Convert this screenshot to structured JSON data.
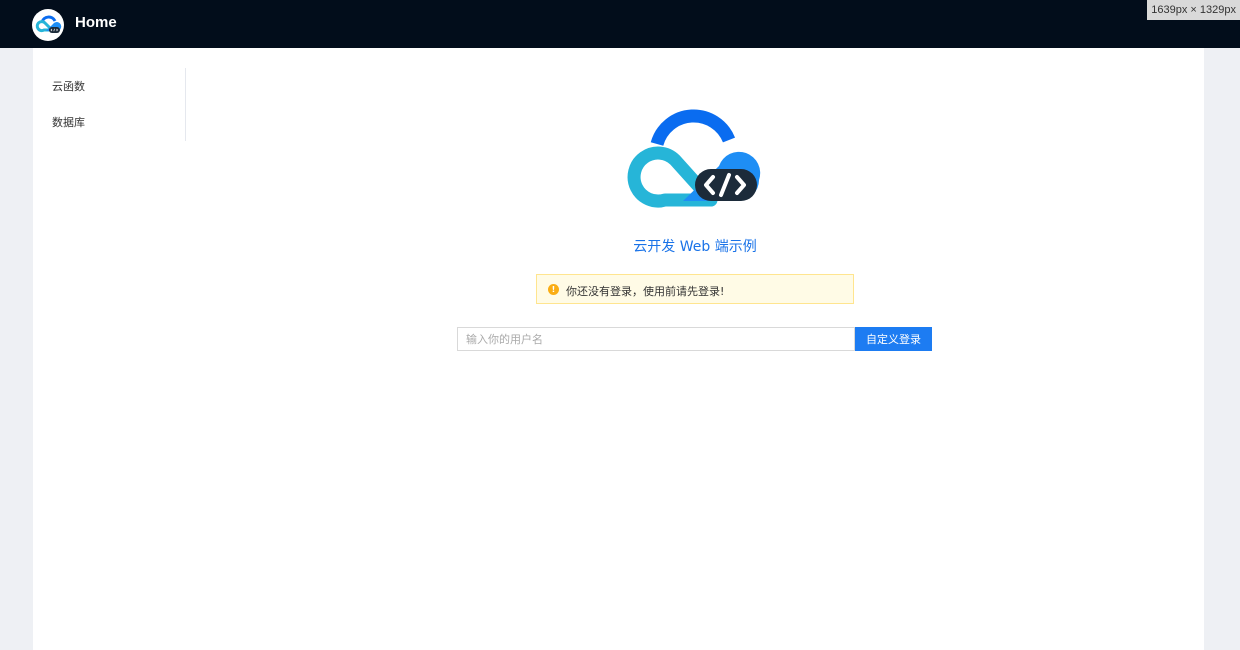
{
  "header": {
    "title": "Home",
    "logo_icon": "cloudbase-logo-icon"
  },
  "size_tag": "1639px × 1329px",
  "sidebar": {
    "items": [
      {
        "label": "云函数"
      },
      {
        "label": "数据库"
      }
    ]
  },
  "main": {
    "logo_icon": "cloudbase-logo-icon",
    "title": "云开发 Web 端示例",
    "alert": {
      "icon": "warning-icon",
      "message": "你还没有登录，使用前请先登录!"
    },
    "login": {
      "input_placeholder": "输入你的用户名",
      "input_value": "",
      "button_label": "自定义登录"
    }
  },
  "colors": {
    "header_bg": "#020d1b",
    "accent": "#1d7cf2",
    "title_blue": "#1a73e8",
    "alert_bg": "#fffbe6",
    "alert_border": "#ffe58f",
    "warning": "#faad14",
    "page_bg": "#eef0f4"
  }
}
